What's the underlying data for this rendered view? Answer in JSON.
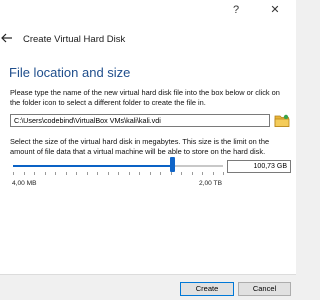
{
  "titlebar": {
    "help_label": "?",
    "close_label": "✕"
  },
  "wizard": {
    "title": "Create Virtual Hard Disk"
  },
  "section": {
    "title": "File location and size",
    "location_description": "Please type the name of the new virtual hard disk file into the box below or click on the folder icon to select a different folder to create the file in.",
    "size_description": "Select the size of the virtual hard disk in megabytes. This size is the limit on the amount of file data that a virtual machine will be able to store on the hard disk."
  },
  "file_path": {
    "value": "C:\\Users\\codebind\\VirtualBox VMs\\kali\\kali.vdi"
  },
  "size": {
    "value": "100,73 GB",
    "min_label": "4,00 MB",
    "max_label": "2,00 TB",
    "slider_fraction": 0.76
  },
  "buttons": {
    "create": "Create",
    "cancel": "Cancel"
  },
  "icons": {
    "back": "back-arrow-icon",
    "folder": "folder-icon"
  },
  "colors": {
    "accent": "#0a62c5",
    "title": "#1f4e8c"
  }
}
